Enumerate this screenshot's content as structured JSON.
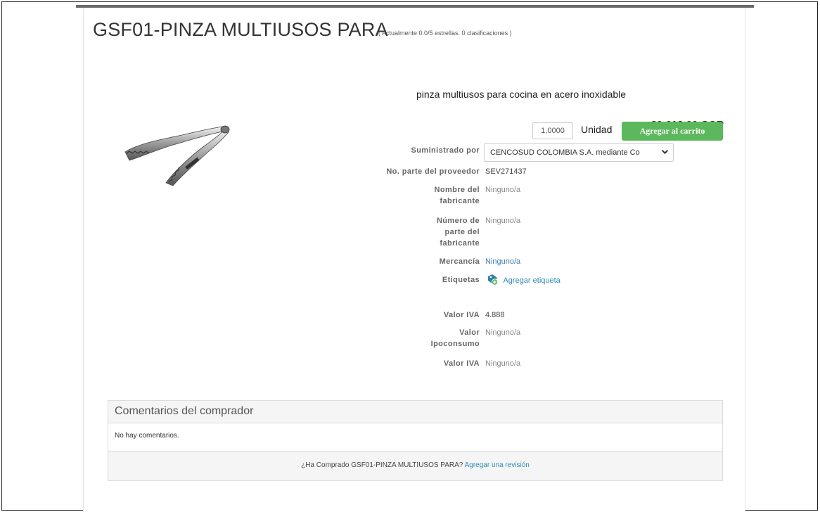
{
  "product": {
    "title": "GSF01-PINZA MULTIUSOS PARA",
    "rating_text": "( Actualmente 0.0/5 estrellas. 0 clasificaciones )",
    "description": "pinza multiusos para cocina en acero inoxidable",
    "price": "30.612,00 COP",
    "image_icon": "kitchen-tongs-image"
  },
  "purchase": {
    "quantity": "1,0000",
    "unit": "Unidad",
    "add_to_cart": "Agregar al carrito"
  },
  "details": {
    "supplier_label": "Suministrado por",
    "supplier_value": "CENCOSUD COLOMBIA S.A. mediante Co",
    "supplier_part_label": "No. parte del proveedor",
    "supplier_part_value": "SEV271437",
    "manufacturer_label_1": "Nombre del",
    "manufacturer_label_2": "fabricante",
    "manufacturer_value": "Ninguno/a",
    "mfr_part_label_1": "Número de",
    "mfr_part_label_2": "parte del",
    "mfr_part_label_3": "fabricante",
    "mfr_part_value": "Ninguno/a",
    "commodity_label": "Mercancía",
    "commodity_value": "Ninguno/a",
    "tags_label": "Etiquetas",
    "tags_link": "Agregar etiqueta",
    "iva_label": "Valor IVA",
    "iva_value": "4.888",
    "ipoconsumo_label_1": "Valor",
    "ipoconsumo_label_2": "Ipoconsumo",
    "ipoconsumo_value": "Ninguno/a",
    "iva2_label": "Valor IVA",
    "iva2_value": "Ninguno/a"
  },
  "reviews": {
    "heading": "Comentarios del comprador",
    "empty_text": "No hay comentarios.",
    "prompt": "¿Ha Comprado GSF01-PINZA MULTIUSOS PARA?",
    "add_review_link": "Agregar una revisión"
  },
  "colors": {
    "cart_button": "#5cb85c",
    "link": "#2a8ab5"
  }
}
